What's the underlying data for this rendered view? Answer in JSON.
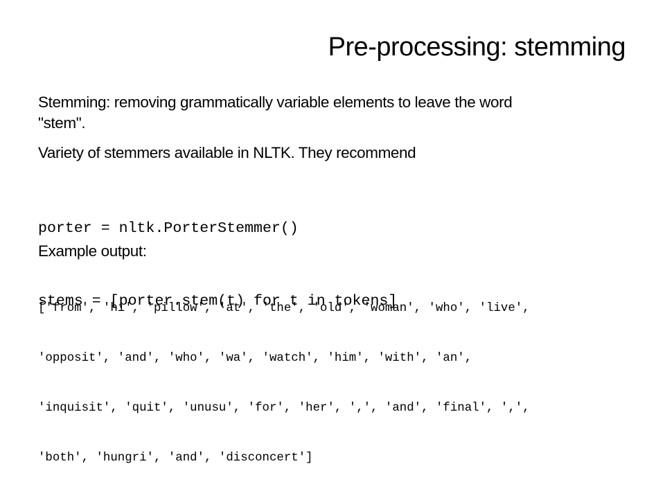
{
  "slide": {
    "title": "Pre-processing: stemming",
    "paragraphs": {
      "definition_line1": "Stemming: removing grammatically variable elements to leave the word",
      "definition_line2": "\"stem\".",
      "recommendation": "Variety of stemmers available in NLTK. They recommend",
      "example_label": "Example output:"
    },
    "code": {
      "lines": [
        "porter = nltk.PorterStemmer()",
        "stems = [porter.stem(t) for t in tokens]"
      ]
    },
    "output": {
      "lines": [
        "['from', 'hi', 'pillow', 'at', 'the', 'old', 'woman', 'who', 'live',",
        "'opposit', 'and', 'who', 'wa', 'watch', 'him', 'with', 'an',",
        "'inquisit', 'quit', 'unusu', 'for', 'her', ',', 'and', 'final', ',',",
        "'both', 'hungri', 'and', 'disconcert']"
      ]
    }
  }
}
